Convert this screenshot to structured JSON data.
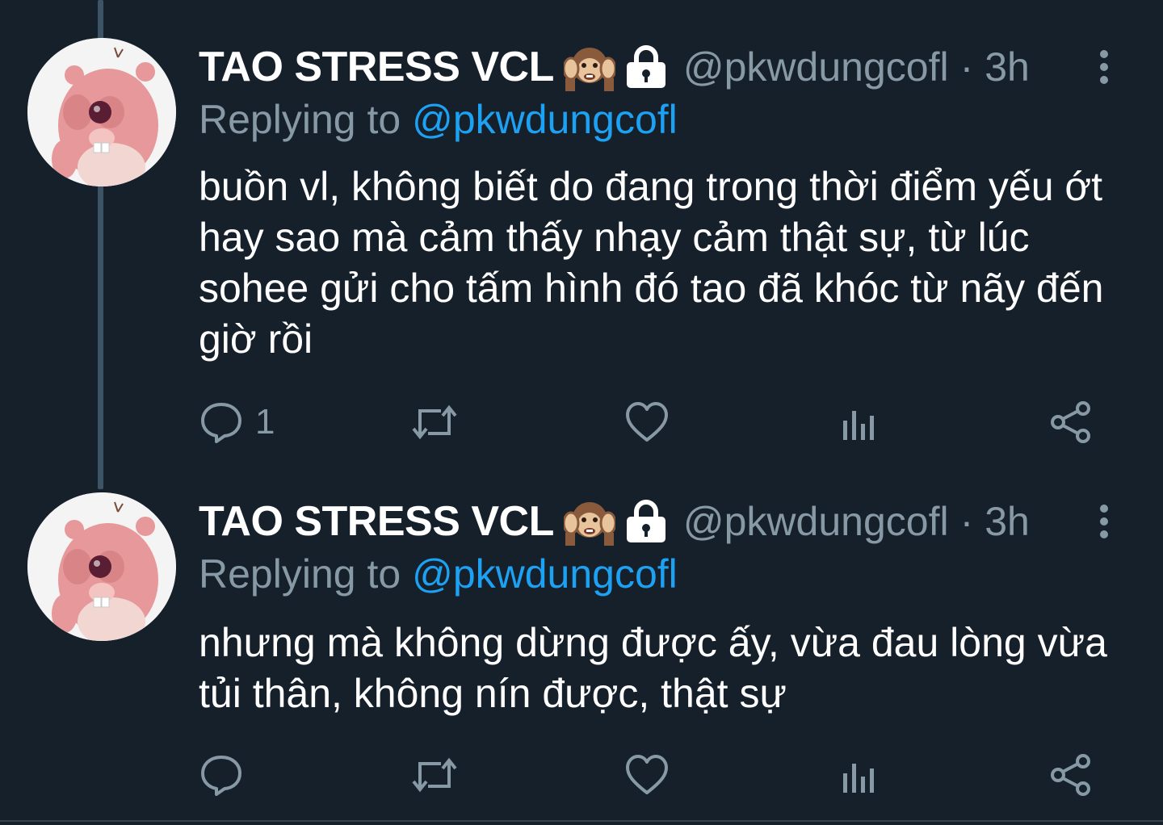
{
  "colors": {
    "background": "#15202b",
    "text": "#ffffff",
    "muted": "#8899a6",
    "link": "#1da1f2",
    "thread_line": "#3d5466"
  },
  "tweets": [
    {
      "display_name": "TAO STRESS VCL",
      "name_emoji": "monkey-covering-ears-emoji",
      "protected_icon": "lock-icon",
      "handle": "@pkwdungcofl",
      "separator": "·",
      "time": "3h",
      "replying_prefix": "Replying to",
      "replying_handle": "@pkwdungcofl",
      "text": "buồn vl, không biết do đang trong thời điểm yếu ớt hay sao mà cảm thấy nhạy cảm thật sự, từ lúc sohee gửi cho tấm hình đó tao đã khóc từ nãy đến giờ rồi",
      "reply_count": "1",
      "retweet_count": "",
      "like_count": ""
    },
    {
      "display_name": "TAO STRESS VCL",
      "name_emoji": "monkey-covering-ears-emoji",
      "protected_icon": "lock-icon",
      "handle": "@pkwdungcofl",
      "separator": "·",
      "time": "3h",
      "replying_prefix": "Replying to",
      "replying_handle": "@pkwdungcofl",
      "text": "nhưng mà không dừng được ấy, vừa đau lòng vừa tủi thân, không nín được, thật sự",
      "reply_count": "",
      "retweet_count": "",
      "like_count": ""
    }
  ]
}
